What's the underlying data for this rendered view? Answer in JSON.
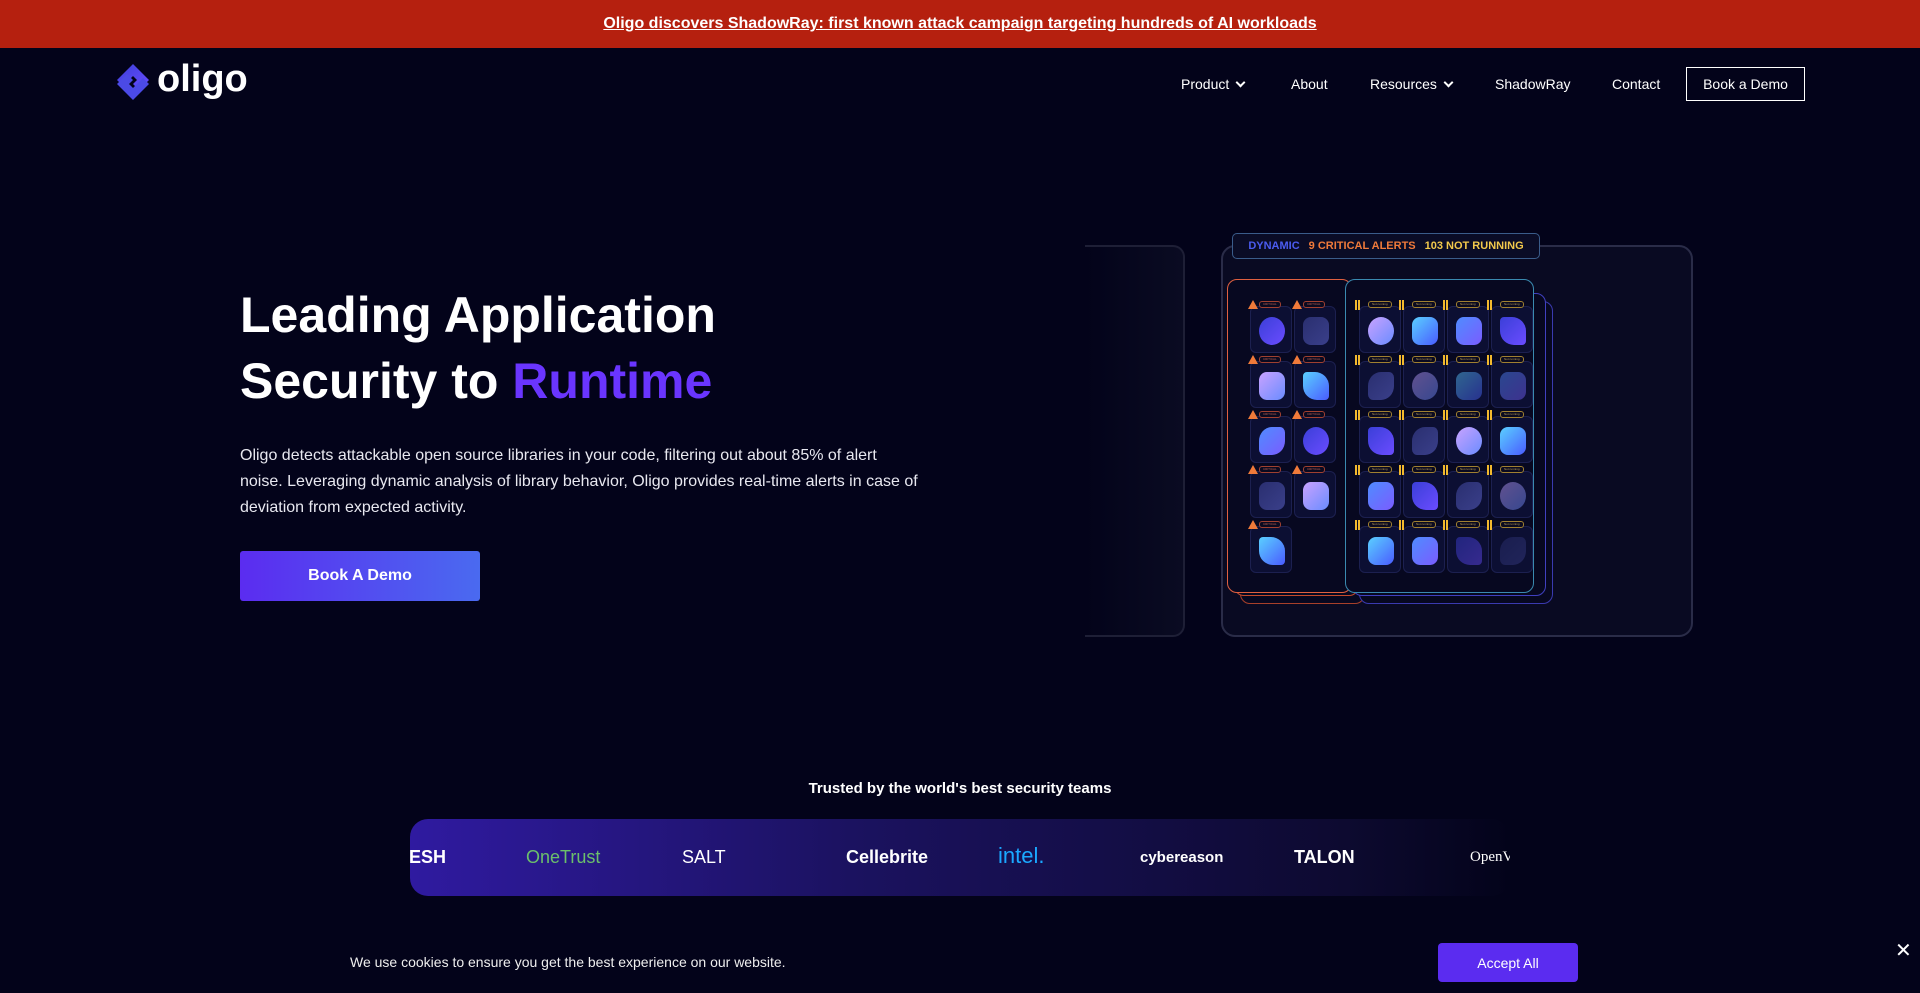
{
  "banner": {
    "text": "Oligo discovers ShadowRay: first known attack campaign targeting hundreds of AI workloads",
    "color": "#b5200f"
  },
  "logo": {
    "text": "oligo"
  },
  "nav": {
    "items": [
      {
        "label": "Product",
        "dropdown": true
      },
      {
        "label": "About"
      },
      {
        "label": "Resources",
        "dropdown": true
      },
      {
        "label": "ShadowRay"
      },
      {
        "label": "Contact"
      }
    ],
    "demo": "Book a Demo"
  },
  "hero": {
    "title_line1": "Leading Application",
    "title_line2_pre": "Security to ",
    "title_accent": "Runtime",
    "accent_color": "#6a35ff",
    "body": "Oligo detects attackable open source libraries in your code, filtering out about 85% of alert noise. Leveraging dynamic analysis of library behavior, Oligo provides real-time alerts in case of deviation from expected activity.",
    "cta": "Book A Demo"
  },
  "dashboard": {
    "mode": "DYNAMIC",
    "critical": "9 CRITICAL ALERTS",
    "not_running": "103 NOT RUNNING",
    "critical_label": "CRITICAL",
    "not_running_label": "Not running",
    "critical_count": 9,
    "not_running_tiles": 20
  },
  "trusted": {
    "heading": "Trusted by the world's best security teams",
    "logos": [
      "IESH",
      "OneTrust",
      "SALT",
      "Cellebrite",
      "intel.",
      "cybereason",
      "TALON",
      "OpenV"
    ]
  },
  "cookie": {
    "text": "We use cookies to ensure you get the best experience on our website.",
    "accept": "Accept All",
    "close": "✕"
  }
}
